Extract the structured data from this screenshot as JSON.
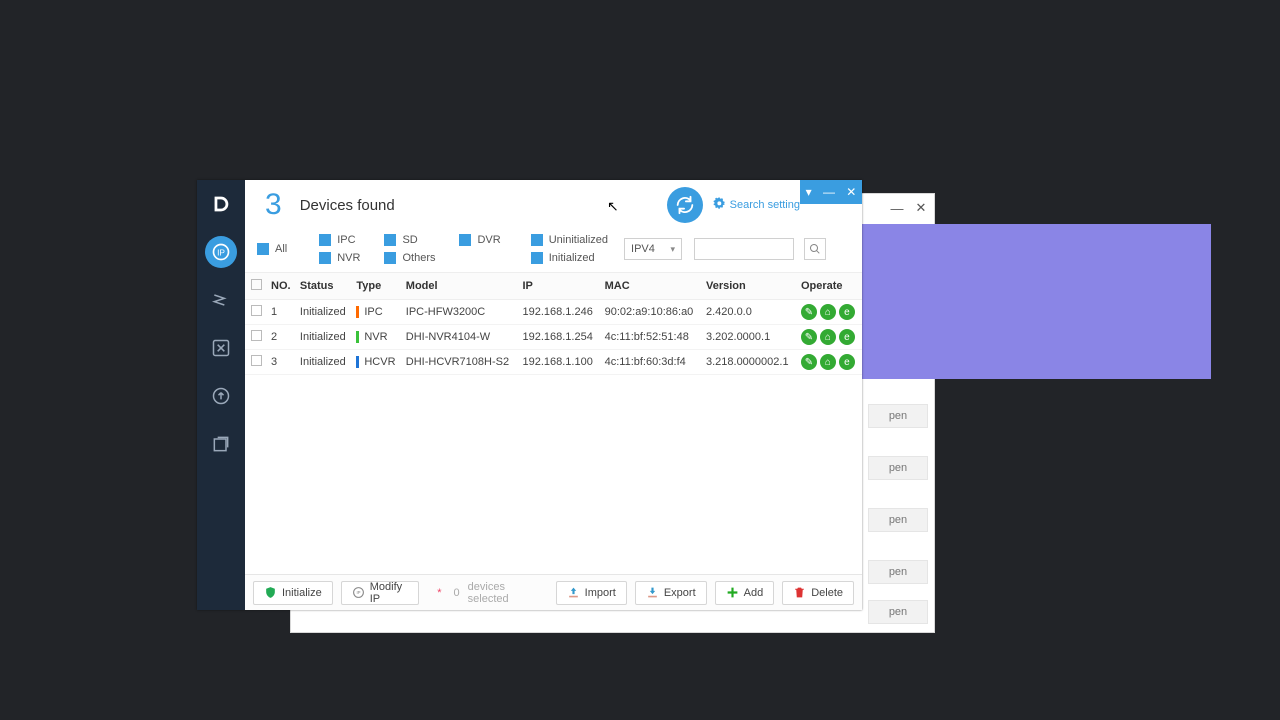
{
  "header": {
    "count": "3",
    "title": "Devices found",
    "search_setting": "Search setting",
    "win": {
      "dropdown": "▾",
      "min": "—",
      "close": "✕"
    }
  },
  "filters": {
    "all": "All",
    "ipc": "IPC",
    "sd": "SD",
    "dvr": "DVR",
    "nvr": "NVR",
    "others": "Others",
    "uninitialized": "Uninitialized",
    "initialized": "Initialized",
    "ip_version": "IPV4",
    "search_placeholder": ""
  },
  "columns": {
    "no": "NO.",
    "status": "Status",
    "type": "Type",
    "model": "Model",
    "ip": "IP",
    "mac": "MAC",
    "version": "Version",
    "operate": "Operate"
  },
  "rows": [
    {
      "no": "1",
      "status": "Initialized",
      "type": "IPC",
      "type_color": "#ff6a00",
      "model": "IPC-HFW3200C",
      "ip": "192.168.1.246",
      "mac": "90:02:a9:10:86:a0",
      "version": "2.420.0.0"
    },
    {
      "no": "2",
      "status": "Initialized",
      "type": "NVR",
      "type_color": "#3ac23a",
      "model": "DHI-NVR4104-W",
      "ip": "192.168.1.254",
      "mac": "4c:11:bf:52:51:48",
      "version": "3.202.0000.1"
    },
    {
      "no": "3",
      "status": "Initialized",
      "type": "HCVR",
      "type_color": "#1e74d6",
      "model": "DHI-HCVR7108H-S2",
      "ip": "192.168.1.100",
      "mac": "4c:11:bf:60:3d:f4",
      "version": "3.218.0000002.1"
    }
  ],
  "operate_icons": {
    "edit": "✎",
    "web": "⌂",
    "browser": "e"
  },
  "bottom": {
    "initialize": "Initialize",
    "modify_ip": "Modify IP",
    "selected_count": "0",
    "selected_label": "devices selected",
    "import": "Import",
    "export": "Export",
    "add": "Add",
    "delete": "Delete"
  },
  "bg_window": {
    "open": "pen",
    "min": "—",
    "close": "✕"
  }
}
